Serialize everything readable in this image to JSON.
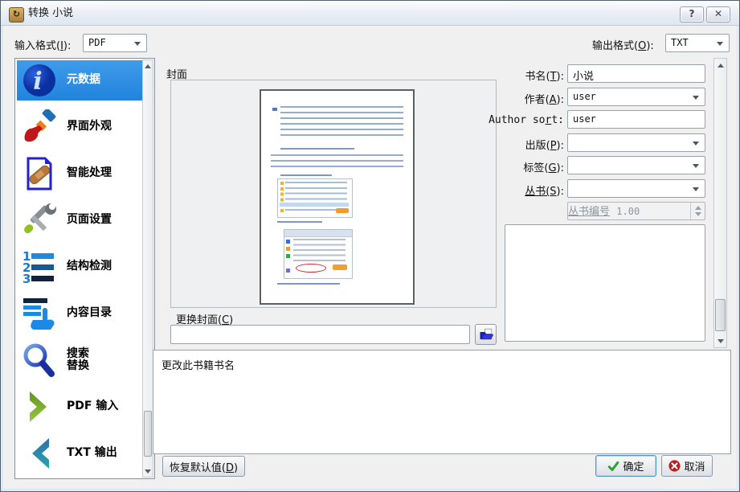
{
  "window": {
    "title": "转换 小说",
    "help_glyph": "?",
    "close_glyph": "✕"
  },
  "format_bar": {
    "input_label": {
      "pre": "输入格式(",
      "key": "I",
      "post": "):"
    },
    "input_value": "PDF",
    "output_label": {
      "pre": "输出格式(",
      "key": "O",
      "post": "):"
    },
    "output_value": "TXT"
  },
  "sidebar": {
    "selected": "元数据",
    "items": [
      {
        "label": "元数据",
        "icon": "metadata-info-icon"
      },
      {
        "label": "界面外观",
        "icon": "paintbrush-icon"
      },
      {
        "label": "智能处理",
        "icon": "document-bandaid-icon"
      },
      {
        "label": "页面设置",
        "icon": "tools-icon"
      },
      {
        "label": "结构检测",
        "icon": "numbered-list-icon"
      },
      {
        "label": "内容目录",
        "icon": "toc-hand-icon"
      },
      {
        "label": "搜索\n替换",
        "icon": "magnifier-icon"
      },
      {
        "label": "PDF 输入",
        "icon": "chevron-right-icon"
      },
      {
        "label": "TXT 输出",
        "icon": "chevron-left-icon"
      }
    ]
  },
  "cover": {
    "section_label": "封面",
    "change_label": {
      "pre": "更换封面(",
      "key": "C",
      "post": ")"
    },
    "path_value": ""
  },
  "metadata": {
    "title": {
      "label": {
        "pre": "书名(",
        "key": "T",
        "post": "):"
      },
      "value": "小说"
    },
    "authors": {
      "label": {
        "pre": "作者(",
        "key": "A",
        "post": "):"
      },
      "value": "user"
    },
    "author_sort": {
      "label": {
        "pre": "Author so",
        "key": "r",
        "post": "t:"
      },
      "value": "user"
    },
    "publisher": {
      "label": {
        "pre": "出版(",
        "key": "P",
        "post": "):"
      },
      "value": ""
    },
    "tags": {
      "label": {
        "pre": "标签(",
        "key": "G",
        "post": "):"
      },
      "value": ""
    },
    "series": {
      "label": {
        "pre": "丛书(",
        "key": "S",
        "post": "):"
      },
      "value": ""
    },
    "series_number": {
      "label": "丛书编号",
      "value": "1.00"
    },
    "comments_value": ""
  },
  "help_panel": {
    "text": "更改此书籍书名"
  },
  "footer": {
    "restore_label": {
      "pre": "恢复默认值(",
      "key": "D",
      "post": ")"
    },
    "ok_label": "确定",
    "cancel_label": "取消"
  },
  "colors": {
    "selected_item_blue": "#2e8de4",
    "ok_check_green": "#2ea12e",
    "cancel_x_red": "#bf1c1c",
    "folder_icon_blue": "#2b2bd6"
  }
}
